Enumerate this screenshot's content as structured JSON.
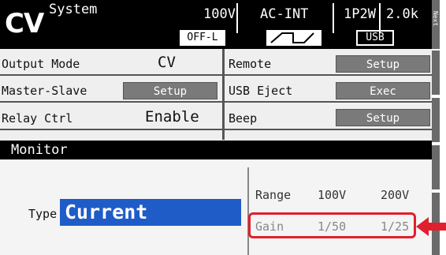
{
  "header": {
    "mode": "CV",
    "menu": "System",
    "voltage": "100V",
    "source": "AC-INT",
    "wiring": "1P2W",
    "range": "2.0k",
    "output_state": "OFF-L",
    "usb": "USB"
  },
  "side": {
    "next_label": "Next"
  },
  "settings": {
    "output_mode": {
      "label": "Output Mode",
      "value": "CV"
    },
    "remote": {
      "label": "Remote",
      "button": "Setup"
    },
    "master_slave": {
      "label": "Master-Slave",
      "button": "Setup"
    },
    "usb_eject": {
      "label": "USB Eject",
      "button": "Exec"
    },
    "relay_ctrl": {
      "label": "Relay Ctrl",
      "value": "Enable"
    },
    "beep": {
      "label": "Beep",
      "button": "Setup"
    }
  },
  "monitor": {
    "title": "Monitor",
    "type_label": "Type",
    "type_value": "Current",
    "range_label": "Range",
    "range_100": "100V",
    "range_200": "200V",
    "gain_label": "Gain",
    "gain_100": "1/50",
    "gain_200": "1/25"
  },
  "colors": {
    "selection": "#1f5cc8",
    "highlight": "#e0202c",
    "button": "#7a7a7a"
  }
}
